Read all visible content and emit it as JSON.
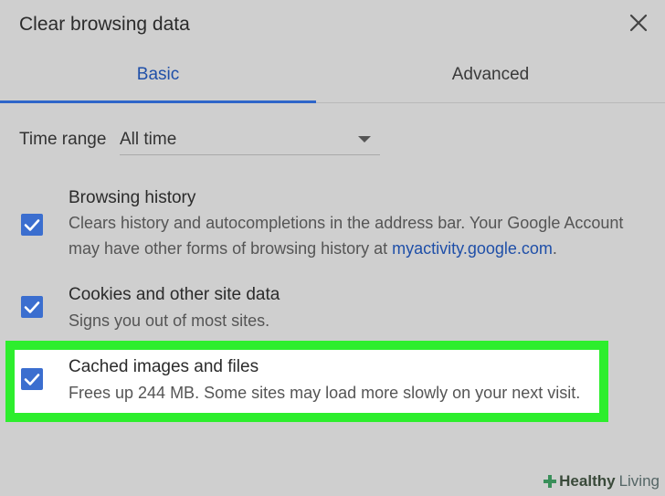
{
  "dialog": {
    "title": "Clear browsing data",
    "close_icon": "close-icon"
  },
  "tabs": [
    {
      "label": "Basic",
      "selected": true
    },
    {
      "label": "Advanced",
      "selected": false
    }
  ],
  "time_range": {
    "label": "Time range",
    "value": "All time"
  },
  "options": [
    {
      "title": "Browsing history",
      "description": "Clears history and autocompletions in the address bar. Your Google Account may have other forms of browsing history at",
      "link": "myactivity.google.com",
      "description_end": ".",
      "checked": true
    },
    {
      "title": "Cookies and other site data",
      "description": "Signs you out of most sites.",
      "checked": true
    },
    {
      "title": "Cached images and files",
      "description": "Frees up 244 MB. Some sites may load more slowly on your next visit.",
      "checked": true
    }
  ],
  "watermark": {
    "brand": "Healthy",
    "brand2": "Living"
  },
  "colors": {
    "accent": "#2f66c9",
    "checkbox": "#3b6ecf",
    "highlight_border": "#2dee2d",
    "background": "#cfcfcf"
  }
}
